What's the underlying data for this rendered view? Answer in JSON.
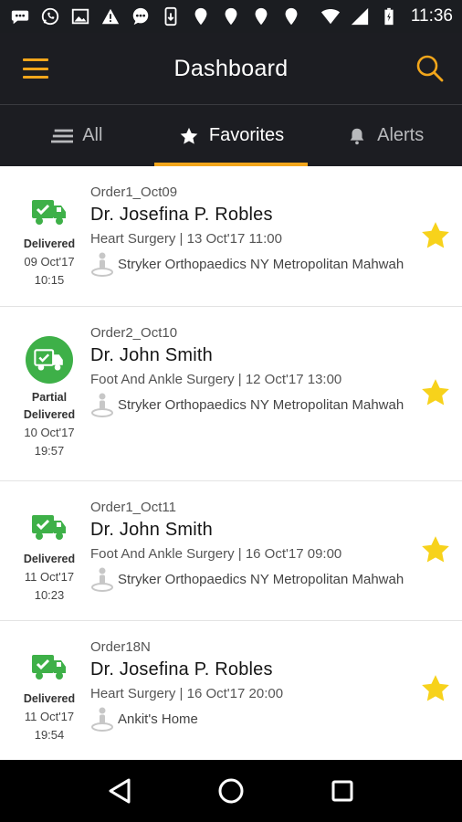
{
  "status_bar": {
    "time": "11:36",
    "notification_icons": [
      "chat-bubble-icon",
      "whatsapp-icon",
      "image-icon",
      "warning-icon",
      "chat-bubble-icon",
      "phone-update-icon",
      "location-pin-icon",
      "location-pin-icon",
      "location-pin-icon",
      "location-pin-icon"
    ],
    "system_icons": [
      "wifi-icon",
      "signal-icon",
      "battery-icon"
    ]
  },
  "app_bar": {
    "title": "Dashboard",
    "menu_icon": "hamburger-icon",
    "search_icon": "search-icon"
  },
  "colors": {
    "accent": "#f2a61b",
    "header_bg": "#1c1d22",
    "delivered_green": "#3eb048",
    "star_yellow": "#f7d21b"
  },
  "tabs": [
    {
      "label": "All",
      "icon": "list-icon",
      "active": false
    },
    {
      "label": "Favorites",
      "icon": "star-icon",
      "active": true
    },
    {
      "label": "Alerts",
      "icon": "bell-icon",
      "active": false
    }
  ],
  "orders": [
    {
      "order_id": "Order1_Oct09",
      "doctor": "Dr. Josefina P. Robles",
      "surgery": "Heart Surgery | 13 Oct'17 11:00",
      "location": "Stryker Orthopaedics NY Metropolitan Mahwah",
      "status_lines": [
        "Delivered"
      ],
      "status_date": "09 Oct'17",
      "status_time": "10:15",
      "status_icon": "delivery-truck-icon",
      "favorite": true
    },
    {
      "order_id": "Order2_Oct10",
      "doctor": "Dr. John Smith",
      "surgery": "Foot And Ankle Surgery | 12 Oct'17 13:00",
      "location": "Stryker Orthopaedics NY Metropolitan Mahwah",
      "status_lines": [
        "Partial",
        "Delivered"
      ],
      "status_date": "10 Oct'17",
      "status_time": "19:57",
      "status_icon": "partial-delivery-truck-icon",
      "favorite": true
    },
    {
      "order_id": "Order1_Oct11",
      "doctor": "Dr. John Smith",
      "surgery": "Foot And Ankle Surgery | 16 Oct'17 09:00",
      "location": "Stryker Orthopaedics NY Metropolitan Mahwah",
      "status_lines": [
        "Delivered"
      ],
      "status_date": "11 Oct'17",
      "status_time": "10:23",
      "status_icon": "delivery-truck-icon",
      "favorite": true
    },
    {
      "order_id": "Order18N",
      "doctor": "Dr. Josefina P. Robles",
      "surgery": "Heart Surgery | 16 Oct'17 20:00",
      "location": "Ankit's Home",
      "status_lines": [
        "Delivered"
      ],
      "status_date": "11 Oct'17",
      "status_time": "19:54",
      "status_icon": "delivery-truck-icon",
      "favorite": true
    }
  ],
  "nav_bar": {
    "buttons": [
      "back-icon",
      "home-icon",
      "recents-icon"
    ]
  }
}
